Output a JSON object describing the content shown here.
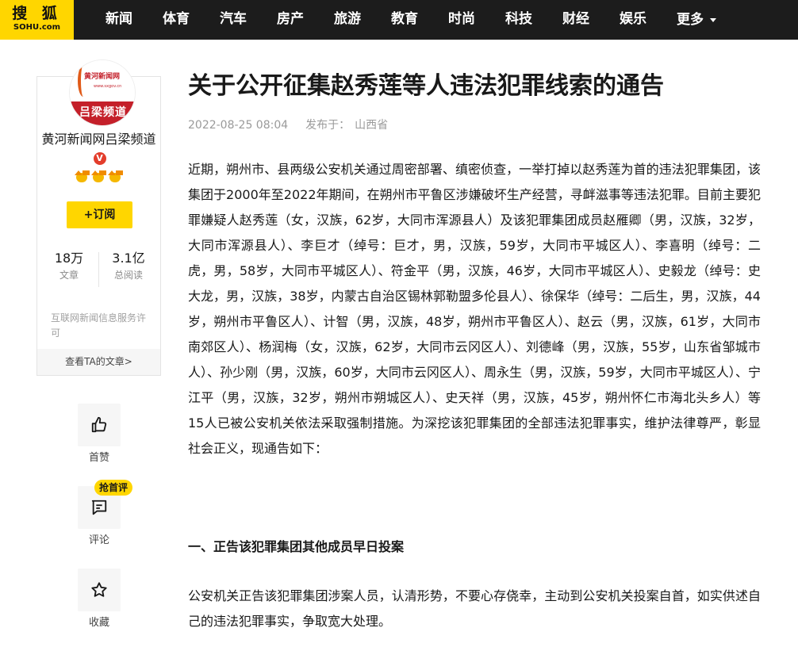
{
  "brand": {
    "logo_top": "搜 狐",
    "logo_bottom": "SOHU.com",
    "color": "#ffd600"
  },
  "nav": {
    "items": [
      "新闻",
      "体育",
      "汽车",
      "房产",
      "旅游",
      "教育",
      "时尚",
      "科技",
      "财经",
      "娱乐"
    ],
    "more_label": "更多"
  },
  "author": {
    "avatar": {
      "logo_name": "黄河新闻网",
      "logo_url": "www.sxgov.cn",
      "band_text": "吕梁频道"
    },
    "name": "黄河新闻网吕梁频道",
    "verified_icon": "v-badge-icon",
    "medal_icon": "fox-medal-icon",
    "subscribe_label": "+订阅",
    "stats": [
      {
        "value": "18万",
        "label": "文章"
      },
      {
        "value": "3.1亿",
        "label": "总阅读"
      }
    ],
    "license": "互联网新闻信息服务许可",
    "view_articles_label": "查看TA的文章>"
  },
  "actions": {
    "like": {
      "label": "首赞",
      "icon": "thumbs-up-icon"
    },
    "comment": {
      "label": "评论",
      "icon": "comment-icon",
      "tag": "抢首评"
    },
    "favorite": {
      "label": "收藏",
      "icon": "star-icon"
    }
  },
  "article": {
    "title": "关于公开征集赵秀莲等人违法犯罪线索的通告",
    "date": "2022-08-25 08:04",
    "published_label": "发布于：",
    "region": "山西省",
    "paragraph1": "近期，朔州市、县两级公安机关通过周密部署、缜密侦查，一举打掉以赵秀莲为首的违法犯罪集团，该集团于2000年至2022年期间，在朔州市平鲁区涉嫌破坏生产经营，寻衅滋事等违法犯罪。目前主要犯罪嫌疑人赵秀莲（女，汉族，62岁，大同市浑源县人）及该犯罪集团成员赵雁卿（男，汉族，32岁，大同市浑源县人）、李巨才（绰号：巨才，男，汉族，59岁，大同市平城区人）、李喜明（绰号：二虎，男，58岁，大同市平城区人）、符金平（男，汉族，46岁，大同市平城区人）、史毅龙（绰号：史大龙，男，汉族，38岁，内蒙古自治区锡林郭勒盟多伦县人）、徐保华（绰号：二后生，男，汉族，44岁，朔州市平鲁区人）、计智（男，汉族，48岁，朔州市平鲁区人）、赵云（男，汉族，61岁，大同市南郊区人）、杨润梅（女，汉族，62岁，大同市云冈区人）、刘德峰（男，汉族，55岁，山东省邹城市人）、孙少刚（男，汉族，60岁，大同市云冈区人）、周永生（男，汉族，59岁，大同市平城区人）、宁江平（男，汉族，32岁，朔州市朔城区人）、史天祥（男，汉族，45岁，朔州怀仁市海北头乡人）等15人已被公安机关依法采取强制措施。为深挖该犯罪集团的全部违法犯罪事实，维护法律尊严，彰显社会正义，现通告如下：",
    "section1_heading": "一、正告该犯罪集团其他成员早日投案",
    "paragraph2": "公安机关正告该犯罪集团涉案人员，认清形势，不要心存侥幸，主动到公安机关投案自首，如实供述自己的违法犯罪事实，争取宽大处理。"
  }
}
